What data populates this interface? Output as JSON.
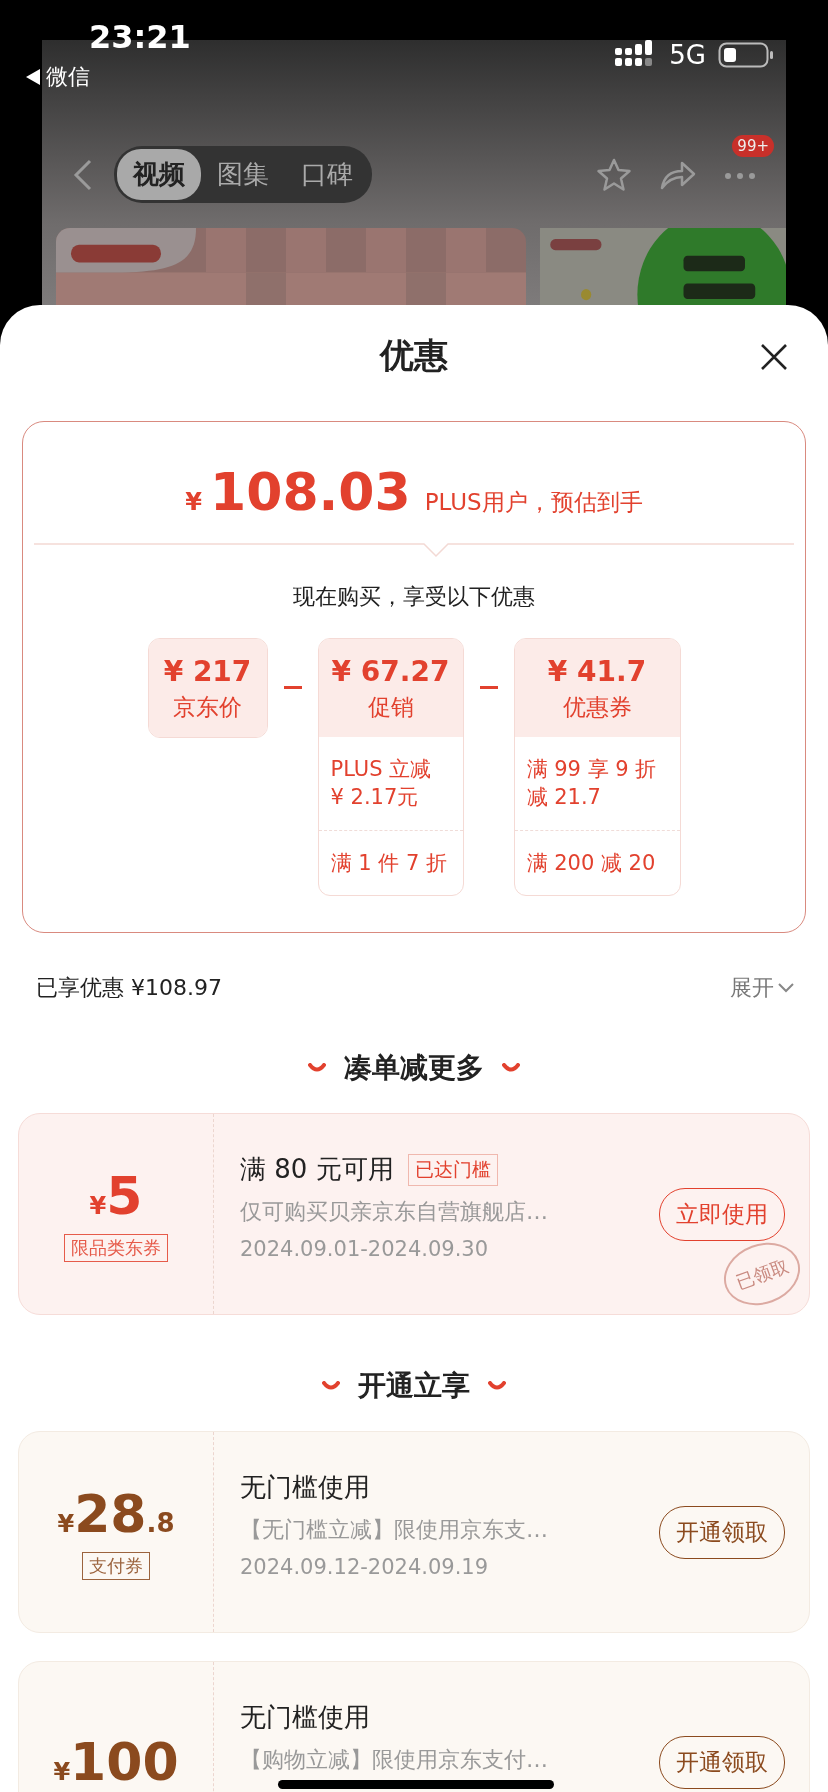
{
  "status_bar": {
    "time": "23:21",
    "back_app": "微信",
    "network": "5G"
  },
  "background_page": {
    "tabs": [
      {
        "label": "视频",
        "selected": true
      },
      {
        "label": "图集",
        "selected": false
      },
      {
        "label": "口碑",
        "selected": false
      }
    ],
    "badge": "99+"
  },
  "sheet": {
    "title": "优惠",
    "estimate": {
      "currency": "¥",
      "amount": "108.03",
      "note": "PLUS用户，预估到手"
    },
    "subtitle": "现在购买，享受以下优惠",
    "breakdown": [
      {
        "amount": "¥ 217",
        "label": "京东价"
      },
      {
        "amount": "¥ 67.27",
        "label": "促销",
        "details": [
          {
            "lines": [
              "PLUS 立减",
              "¥ 2.17元"
            ]
          },
          {
            "lines": [
              "满 1 件 7 折"
            ]
          }
        ]
      },
      {
        "amount": "¥ 41.7",
        "label": "优惠券",
        "details": [
          {
            "lines": [
              "满 99 享 9 折",
              "减 21.7"
            ]
          },
          {
            "lines": [
              "满 200 减 20"
            ]
          }
        ]
      }
    ],
    "summary": {
      "label": "已享优惠 ¥108.97",
      "expand": "展开"
    },
    "sections": [
      {
        "title": "凑单减更多",
        "coupons": [
          {
            "kind": "store",
            "currency": "¥",
            "amount": "5",
            "tag": "限品类东券",
            "title": "满 80 元可用",
            "badge": "已达门槛",
            "desc": "仅可购买贝亲京东自营旗舰店…",
            "dates": "2024.09.01-2024.09.30",
            "button": "立即使用",
            "stamp": "已领取"
          }
        ]
      },
      {
        "title": "开通立享",
        "coupons": [
          {
            "kind": "payment",
            "currency": "¥",
            "amount": "28",
            "decimal": ".8",
            "tag": "支付券",
            "title": "无门槛使用",
            "desc": "【无门槛立减】限使用京东支…",
            "dates": "2024.09.12-2024.09.19",
            "button": "开通领取"
          },
          {
            "kind": "payment",
            "currency": "¥",
            "amount": "100",
            "title": "无门槛使用",
            "desc": "【购物立减】限使用京东支付…",
            "button": "开通领取"
          }
        ]
      }
    ]
  }
}
